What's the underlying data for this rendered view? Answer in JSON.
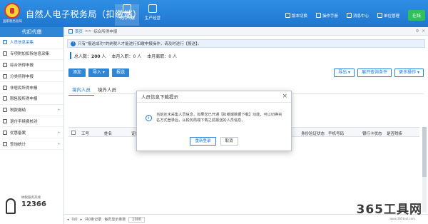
{
  "header": {
    "app_title": "自然人电子税务局（扣缴端）",
    "brand_sub": "国家税务总局",
    "tabs": [
      {
        "label": "代扣代缴"
      },
      {
        "label": "生产经营"
      }
    ],
    "menu": [
      {
        "label": "版本切换"
      },
      {
        "label": "操作手册"
      },
      {
        "label": "消息中心"
      },
      {
        "label": "单位管理"
      }
    ],
    "online_label": "在线"
  },
  "sidebar": {
    "title": "代扣代缴",
    "items": [
      {
        "label": "人员信息采集"
      },
      {
        "label": "专项附加扣除信息采集"
      },
      {
        "label": "综合所得申报"
      },
      {
        "label": "分类所得申报"
      },
      {
        "label": "非居民所得申报"
      },
      {
        "label": "限售股所得申报"
      },
      {
        "label": "税款缴纳"
      },
      {
        "label": "退付手续费核对"
      },
      {
        "label": "优惠备案"
      },
      {
        "label": "查询统计"
      }
    ],
    "hotline_label": "纳税服务热线",
    "hotline_number": "12366"
  },
  "main": {
    "breadcrumb": {
      "home": "首页",
      "sep": ">>",
      "current": "综合所得申报"
    },
    "notice": "只有“报送成功”的纳税人才能进行扣缴申报操作，请及时进行【报送】。",
    "stats": {
      "total_label": "总人数：",
      "total": "200",
      "total_unit": "人",
      "entry_label": "本月入职：",
      "entry": "0",
      "entry_unit": "人",
      "leave_label": "本月离职：",
      "leave": "0",
      "leave_unit": "人"
    },
    "toolbar": {
      "add": "添加",
      "import": "导入 ▾",
      "submit": "报送"
    },
    "toolbar_right": {
      "export": "导出 ▾",
      "show_query": "展开查询条件",
      "more": "更多操作 ▾"
    },
    "tabs": [
      {
        "label": "境内人员"
      },
      {
        "label": "境外人员"
      }
    ],
    "columns": [
      "工号",
      "姓名",
      "证件",
      "身份验证状态",
      "手机号码",
      "银行卡状态",
      "是否残疾"
    ],
    "footer": {
      "records": "共0条记录",
      "per_page_label": "每页显示条数",
      "per_page": "1000",
      "page_info": "0/0"
    }
  },
  "modal": {
    "title": "人员信息下载提示",
    "message": "当前还未采集人员信息，如果您已开通【扣缴端数据下载】功能，可以切换实名方式登录后，从税务局端下载之前报送的人员信息。",
    "relogin": "重新登录",
    "cancel": "取消"
  },
  "watermark": {
    "text": "365工具网",
    "sub": "www.365tool.com"
  }
}
